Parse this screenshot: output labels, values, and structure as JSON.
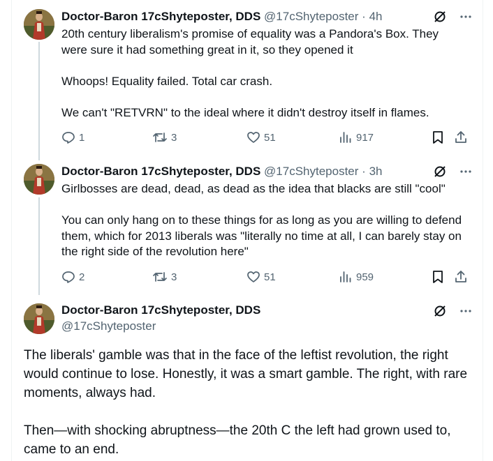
{
  "tweets": [
    {
      "name": "Doctor-Baron 17cShyteposter, DDS",
      "handle": "@17cShyteposter",
      "separator": "·",
      "time": "4h",
      "lines": [
        "20th century liberalism's promise of equality was a Pandora's Box. They were sure it had something great in it, so they opened it",
        "Whoops! Equality failed. Total car crash.",
        "We can't \"RETVRN\" to the ideal where it didn't destroy itself in flames."
      ],
      "replies": "1",
      "reposts": "3",
      "likes": "51",
      "views": "917"
    },
    {
      "name": "Doctor-Baron 17cShyteposter, DDS",
      "handle": "@17cShyteposter",
      "separator": "·",
      "time": "3h",
      "lines": [
        "Girlbosses are dead, dead, as dead as the idea that blacks are still \"cool\"",
        "You can only hang on to these things for as long as you are willing to defend them, which for 2013 liberals was \"literally no time at all, I can barely stay on the right side of the revolution here\""
      ],
      "replies": "2",
      "reposts": "3",
      "likes": "51",
      "views": "959"
    }
  ],
  "main_tweet": {
    "name": "Doctor-Baron 17cShyteposter, DDS",
    "handle": "@17cShyteposter",
    "paragraphs": [
      "The liberals' gamble was that in the face of the leftist revolution, the right would continue to lose. Honestly, it was a smart gamble. The right, with rare moments, always had.",
      "Then—with shocking abruptness—the 20th C the left had grown used to, came to an end."
    ]
  },
  "icons": {
    "grok": "grok-icon",
    "more": "more-icon",
    "reply": "reply-icon",
    "repost": "repost-icon",
    "like": "like-icon",
    "views": "views-icon",
    "bookmark": "bookmark-icon",
    "share": "share-icon"
  },
  "colors": {
    "text": "#0f1419",
    "muted": "#536471",
    "line": "#cfd9de"
  }
}
